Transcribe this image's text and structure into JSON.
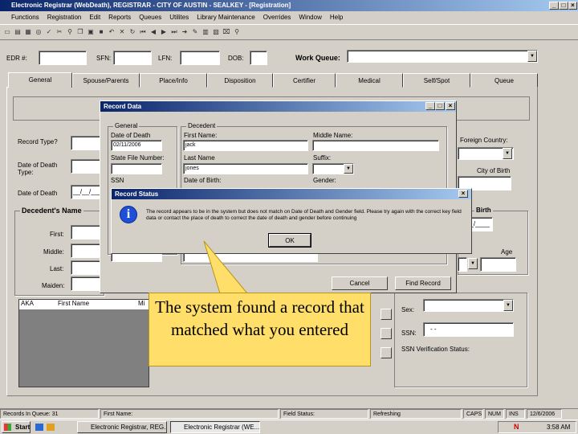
{
  "window": {
    "title": "Electronic Registrar (WebDeath), REGISTRAR - CITY OF AUSTIN - SEALKEY - [Registration]"
  },
  "menu": [
    "Functions",
    "Registration",
    "Edit",
    "Reports",
    "Queues",
    "Utilites",
    "Library Maintenance",
    "Overrides",
    "Window",
    "Help"
  ],
  "topfields": {
    "edrs": "EDR #:",
    "sfn": "SFN:",
    "lfn": "LFN:",
    "dob": "DOB:",
    "work_queue": "Work Queue:"
  },
  "tabs": [
    "General",
    "Spouse/Parents",
    "Place/Info",
    "Disposition",
    "Certifier",
    "Medical",
    "Self/Spot",
    "Queue"
  ],
  "left": {
    "record_type": "Record Type?",
    "date_of_death_type": "Date of Death Type:",
    "date_of_death": "Date of Death",
    "date_value": "__/__/____",
    "decedent_name": "Decedent's Name",
    "first": "First:",
    "middle": "Middle:",
    "last": "Last:",
    "maiden": "Maiden:"
  },
  "right": {
    "foreign_country": "Foreign Country:",
    "city_of_birth": "City of Birth",
    "birth": "Birth",
    "age": "Age",
    "birth_date_value": "__/____",
    "sex": "Sex:",
    "ssn": "SSN:",
    "ssn_value": "-  -",
    "ssn_verification": "SSN Verification Status:"
  },
  "aka": {
    "col1": "AKA",
    "col2": "First Name",
    "col3": "Mi"
  },
  "record_dialog": {
    "title": "Record Data",
    "general": "General",
    "date_of_death_label": "Date of Death",
    "date_of_death_value": "02/11/2006",
    "state_file_label": "State File Number:",
    "ssn_label": "SSN",
    "decedent": "Decedent",
    "first_name_label": "First Name:",
    "first_name_value": "jack",
    "middle_name_label": "Middle Name:",
    "last_name_label": "Last Name",
    "last_name_value": "jones",
    "suffix_label": "Suffix:",
    "date_of_birth_label": "Date of Birth:",
    "gender_label": "Gender:",
    "cancel": "Cancel",
    "find_record": "Find Record"
  },
  "status_dialog": {
    "title": "Record Status",
    "message": "The record appears to be in the system but does not match on Date of Death and Gender field. Please try again with the correct key field data or contact the place of death to correct the date of death and gender before continuing",
    "ok": "OK"
  },
  "callout": {
    "text": "The system found a record that matched what you entered"
  },
  "statusbar": [
    "Records In Queue: 31",
    "First Name:",
    "Field Status:",
    "Refreshing",
    "CAPS",
    "NUM",
    "INS",
    "12/6/2006"
  ],
  "taskbar": {
    "start": "Start",
    "item1": "Electronic Registrar, REG...",
    "item2": "Electronic Registrar (WE...",
    "clock": "3:58 AM"
  }
}
